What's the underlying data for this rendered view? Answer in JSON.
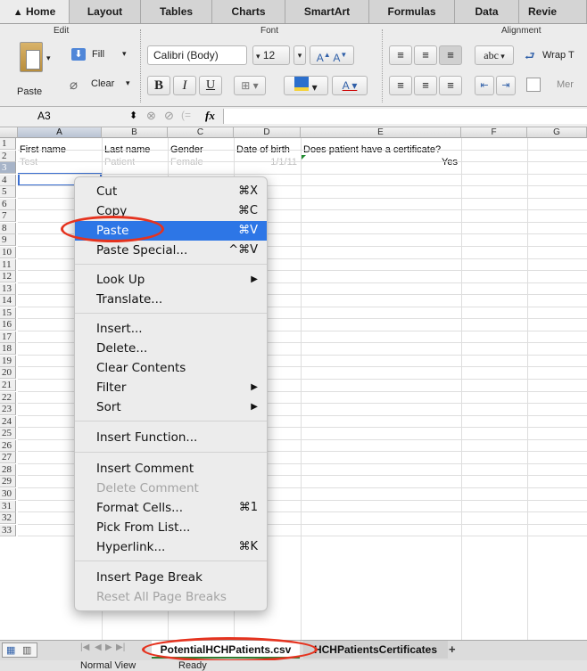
{
  "tabs": [
    "Home",
    "Layout",
    "Tables",
    "Charts",
    "SmartArt",
    "Formulas",
    "Data",
    "Revie"
  ],
  "ribbon": {
    "edit_label": "Edit",
    "font_label": "Font",
    "alignment_label": "Alignment",
    "paste": "Paste",
    "fill": "Fill",
    "clear": "Clear",
    "font_name": "Calibri (Body)",
    "font_size": "12",
    "bold": "B",
    "italic": "I",
    "underline": "U",
    "wrap_text": "Wrap T",
    "abc": "abc",
    "merge": "Mer"
  },
  "formula_bar": {
    "name_box": "A3",
    "fx": "fx"
  },
  "grid": {
    "columns": [
      "A",
      "B",
      "C",
      "D",
      "E",
      "F",
      "G"
    ],
    "rows": [
      "1",
      "2",
      "3",
      "4",
      "5",
      "6",
      "7",
      "8",
      "9",
      "10",
      "11",
      "12",
      "13",
      "14",
      "15",
      "16",
      "17",
      "18",
      "19",
      "20",
      "21",
      "22",
      "23",
      "24",
      "25",
      "26",
      "27",
      "28",
      "29",
      "30",
      "31",
      "32",
      "33"
    ],
    "header_row": [
      "First name",
      "Last name",
      "Gender",
      "Date of birth",
      "Does patient have a certificate?"
    ],
    "row2": [
      "Test",
      "Patient",
      "Female",
      "1/1/11",
      "Yes"
    ]
  },
  "context_menu": {
    "cut": "Cut",
    "cut_sc": "⌘X",
    "copy": "Copy",
    "copy_sc": "⌘C",
    "paste": "Paste",
    "paste_sc": "⌘V",
    "paste_special": "Paste Special...",
    "paste_special_sc": "^⌘V",
    "look_up": "Look Up",
    "translate": "Translate...",
    "insert": "Insert...",
    "delete": "Delete...",
    "clear_contents": "Clear Contents",
    "filter": "Filter",
    "sort": "Sort",
    "insert_function": "Insert Function...",
    "insert_comment": "Insert Comment",
    "delete_comment": "Delete Comment",
    "format_cells": "Format Cells...",
    "format_cells_sc": "⌘1",
    "pick_from_list": "Pick From List...",
    "hyperlink": "Hyperlink...",
    "hyperlink_sc": "⌘K",
    "insert_page_break": "Insert Page Break",
    "reset_page_breaks": "Reset All Page Breaks"
  },
  "sheets": [
    "PotentialHCHPatients.csv",
    "HCHPatientsCertificates"
  ],
  "status": {
    "view": "Normal View",
    "state": "Ready"
  },
  "colors": {
    "accent": "#2d76e6",
    "annotation": "#e5331f"
  }
}
